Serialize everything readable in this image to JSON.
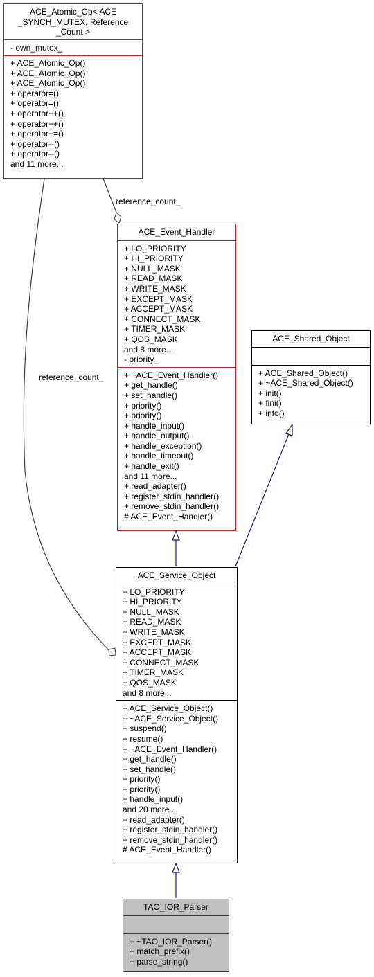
{
  "nodes": {
    "atomic_op": {
      "title": "ACE_Atomic_Op< ACE\n_SYNCH_MUTEX, Reference\n_Count >",
      "title_lines": [
        "ACE_Atomic_Op< ACE",
        "_SYNCH_MUTEX, Reference",
        "_Count >"
      ],
      "attributes": [
        "- own_mutex_"
      ],
      "methods": [
        "+ ACE_Atomic_Op()",
        "+ ACE_Atomic_Op()",
        "+ ACE_Atomic_Op()",
        "+ operator=()",
        "+ operator=()",
        "+ operator++()",
        "+ operator++()",
        "+ operator+=()",
        "+ operator--()",
        "+ operator--()",
        "and 11 more..."
      ]
    },
    "event_handler": {
      "title": "ACE_Event_Handler",
      "attributes": [
        "+ LO_PRIORITY",
        "+ HI_PRIORITY",
        "+ NULL_MASK",
        "+ READ_MASK",
        "+ WRITE_MASK",
        "+ EXCEPT_MASK",
        "+ ACCEPT_MASK",
        "+ CONNECT_MASK",
        "+ TIMER_MASK",
        "+ QOS_MASK",
        "and 8 more...",
        "- priority_"
      ],
      "methods": [
        "+ ~ACE_Event_Handler()",
        "+ get_handle()",
        "+ set_handle()",
        "+ priority()",
        "+ priority()",
        "+ handle_input()",
        "+ handle_output()",
        "+ handle_exception()",
        "+ handle_timeout()",
        "+ handle_exit()",
        "and 11 more...",
        "+ read_adapter()",
        "+ register_stdin_handler()",
        "+ remove_stdin_handler()",
        "# ACE_Event_Handler()"
      ]
    },
    "shared_object": {
      "title": "ACE_Shared_Object",
      "attributes": [],
      "methods": [
        "+ ACE_Shared_Object()",
        "+ ~ACE_Shared_Object()",
        "+ init()",
        "+ fini()",
        "+ info()"
      ]
    },
    "service_object": {
      "title": "ACE_Service_Object",
      "attributes": [
        "+ LO_PRIORITY",
        "+ HI_PRIORITY",
        "+ NULL_MASK",
        "+ READ_MASK",
        "+ WRITE_MASK",
        "+ EXCEPT_MASK",
        "+ ACCEPT_MASK",
        "+ CONNECT_MASK",
        "+ TIMER_MASK",
        "+ QOS_MASK",
        "and 8 more..."
      ],
      "methods": [
        "+ ACE_Service_Object()",
        "+ ~ACE_Service_Object()",
        "+ suspend()",
        "+ resume()",
        "+ ~ACE_Event_Handler()",
        "+ get_handle()",
        "+ set_handle()",
        "+ priority()",
        "+ priority()",
        "+ handle_input()",
        "and 20 more...",
        "+ read_adapter()",
        "+ register_stdin_handler()",
        "+ remove_stdin_handler()",
        "# ACE_Event_Handler()"
      ]
    },
    "ior_parser": {
      "title": "TAO_IOR_Parser",
      "attributes": [],
      "methods": [
        "+ ~TAO_IOR_Parser()",
        "+ match_prefix()",
        "+ parse_string()"
      ]
    }
  },
  "edges": {
    "ref_count_label_1": "reference_count_",
    "ref_count_label_2": "reference_count_"
  },
  "colors": {
    "highlight_border": "#e31a1c",
    "normal_border": "#000000",
    "current_fill": "#bfbfbf",
    "inheritance_edge": "#191970",
    "usage_edge": "#404040"
  }
}
